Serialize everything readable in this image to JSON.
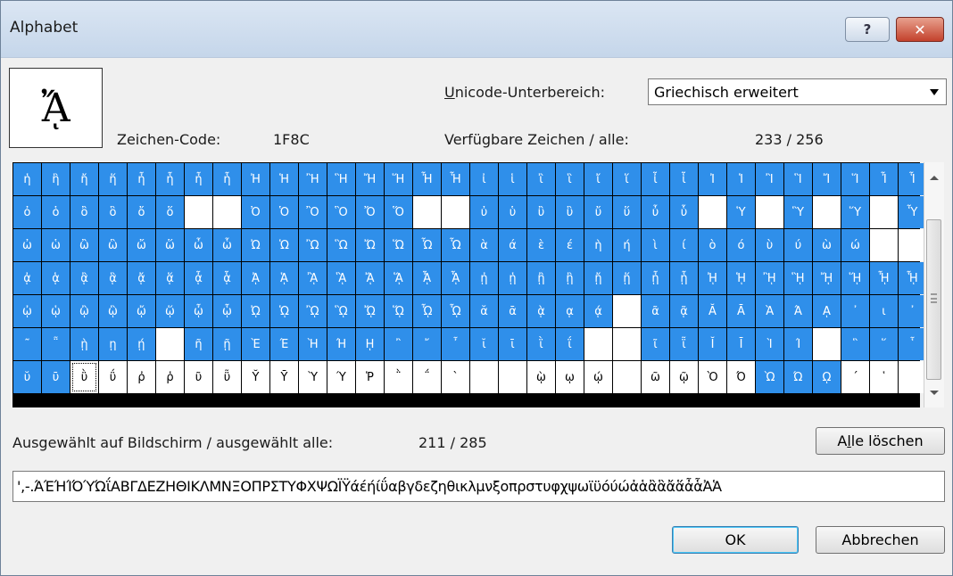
{
  "window": {
    "title": "Alphabet"
  },
  "titlebar_buttons": {
    "help": "?",
    "close": "✕"
  },
  "preview": {
    "glyph": "ᾌ"
  },
  "labels": {
    "code_label": "Zeichen-Code:",
    "code_value": "1F8C",
    "subrange_label_u": "U",
    "subrange_label_rest": "nicode-Unterbereich:",
    "available_label": "Verfügbare Zeichen / alle:",
    "available_value": "233 / 256",
    "selected_label": "Ausgewählt auf Bildschirm / ausgewählt alle:",
    "selected_value": "211 / 285"
  },
  "subrange_select": {
    "value": "Griechisch erweitert"
  },
  "buttons": {
    "clear_all_pre": "A",
    "clear_all_u": "l",
    "clear_all_post": "le löschen",
    "ok": "OK",
    "cancel": "Abbrechen"
  },
  "selection_text": "',-.ΆΈΉΊΌΎΏΐΑΒΓΔΕΖΗΘΙΚΛΜΝΞΟΠΡΣΤΥΦΧΨΩΪΫάέήίΰαβγδεζηθικλμνξοπρστυφχψωϊϋόύώἀἁἂἃἄἅἆἇἈἉ",
  "grid": {
    "colors": {
      "selected": "#2f8fea",
      "unselected": "#ffffff"
    },
    "rows": [
      {
        "c": [
          "ἡ",
          "ἣ",
          "ἤ",
          "ἥ",
          "ἦ",
          "ἧ",
          "ἦ",
          "ἧ",
          "Ἠ",
          "Ἡ",
          "Ἢ",
          "Ἣ",
          "Ἤ",
          "Ἥ",
          "Ἦ",
          "Ἧ",
          "ἰ",
          "ἱ",
          "ἲ",
          "ἳ",
          "ἴ",
          "ἵ",
          "ἶ",
          "ἷ",
          "Ἰ",
          "Ἱ",
          "Ἲ",
          "Ἳ",
          "Ἴ",
          "Ἵ",
          "Ἶ",
          "Ἷ"
        ],
        "s": "11111111111111111111111111111111"
      },
      {
        "c": [
          "ὀ",
          "ὁ",
          "ὂ",
          "ὃ",
          "ὄ",
          "ὅ",
          "",
          "",
          "Ὀ",
          "Ὁ",
          "Ὂ",
          "Ὃ",
          "Ὄ",
          "Ὅ",
          "",
          "",
          "ὐ",
          "ὑ",
          "ὒ",
          "ὓ",
          "ὔ",
          "ὕ",
          "ὖ",
          "ὗ",
          "",
          "Ὑ",
          "",
          "Ὓ",
          "",
          "Ὕ",
          "",
          "Ὗ"
        ],
        "s": "11111100111111001111111101010101"
      },
      {
        "c": [
          "ὠ",
          "ὡ",
          "ὢ",
          "ὣ",
          "ὤ",
          "ὥ",
          "ὦ",
          "ὧ",
          "Ὠ",
          "Ὡ",
          "Ὢ",
          "Ὣ",
          "Ὤ",
          "Ὥ",
          "Ὦ",
          "Ὧ",
          "ὰ",
          "ά",
          "ὲ",
          "έ",
          "ὴ",
          "ή",
          "ὶ",
          "ί",
          "ὸ",
          "ό",
          "ὺ",
          "ύ",
          "ὼ",
          "ώ",
          "",
          ""
        ],
        "s": "11111111111111111111111111111100"
      },
      {
        "c": [
          "ᾀ",
          "ᾁ",
          "ᾂ",
          "ᾃ",
          "ᾄ",
          "ᾅ",
          "ᾆ",
          "ᾇ",
          "ᾈ",
          "ᾉ",
          "ᾊ",
          "ᾋ",
          "ᾌ",
          "ᾍ",
          "ᾎ",
          "ᾏ",
          "ᾐ",
          "ᾑ",
          "ᾒ",
          "ᾓ",
          "ᾔ",
          "ᾕ",
          "ᾖ",
          "ᾗ",
          "ᾘ",
          "ᾙ",
          "ᾚ",
          "ᾛ",
          "ᾜ",
          "ᾝ",
          "ᾞ",
          "ᾟ"
        ],
        "s": "11111111111111111111111111111111"
      },
      {
        "c": [
          "ᾠ",
          "ᾡ",
          "ᾢ",
          "ᾣ",
          "ᾤ",
          "ᾥ",
          "ᾦ",
          "ᾧ",
          "ᾨ",
          "ᾩ",
          "ᾪ",
          "ᾫ",
          "ᾬ",
          "ᾭ",
          "ᾮ",
          "ᾯ",
          "ᾰ",
          "ᾱ",
          "ᾲ",
          "ᾳ",
          "ᾴ",
          "",
          "ᾶ",
          "ᾷ",
          "Ᾰ",
          "Ᾱ",
          "Ὰ",
          "Ά",
          "ᾼ",
          "᾽",
          "ι",
          "᾿"
        ],
        "s": "11111111111111111111101111111111"
      },
      {
        "c": [
          "῀",
          "῁",
          "ῂ",
          "ῃ",
          "ῄ",
          "",
          "ῆ",
          "ῇ",
          "Ὲ",
          "Έ",
          "Ὴ",
          "Ή",
          "ῌ",
          "῍",
          "῎",
          "῏",
          "ῐ",
          "ῑ",
          "ῒ",
          "ΐ",
          "",
          "",
          "ῖ",
          "ῗ",
          "Ῐ",
          "Ῑ",
          "Ὶ",
          "Ί",
          "",
          "῝",
          "῞",
          "῟"
        ],
        "s": "11111011111111111111001111110111"
      },
      {
        "c": [
          "ῠ",
          "ῡ",
          "ῢ",
          "ΰ",
          "ῤ",
          "ῥ",
          "ῦ",
          "ῧ",
          "Ῠ",
          "Ῡ",
          "Ὺ",
          "Ύ",
          "Ῥ",
          "῭",
          "΅",
          "`",
          "",
          "",
          "ῲ",
          "ῳ",
          "ῴ",
          "",
          "ῶ",
          "ῷ",
          "Ὸ",
          "Ό",
          "Ὼ",
          "Ώ",
          "ῼ",
          "´",
          "῾",
          ""
        ],
        "s": "11000000000000000000000000111000"
      }
    ]
  }
}
